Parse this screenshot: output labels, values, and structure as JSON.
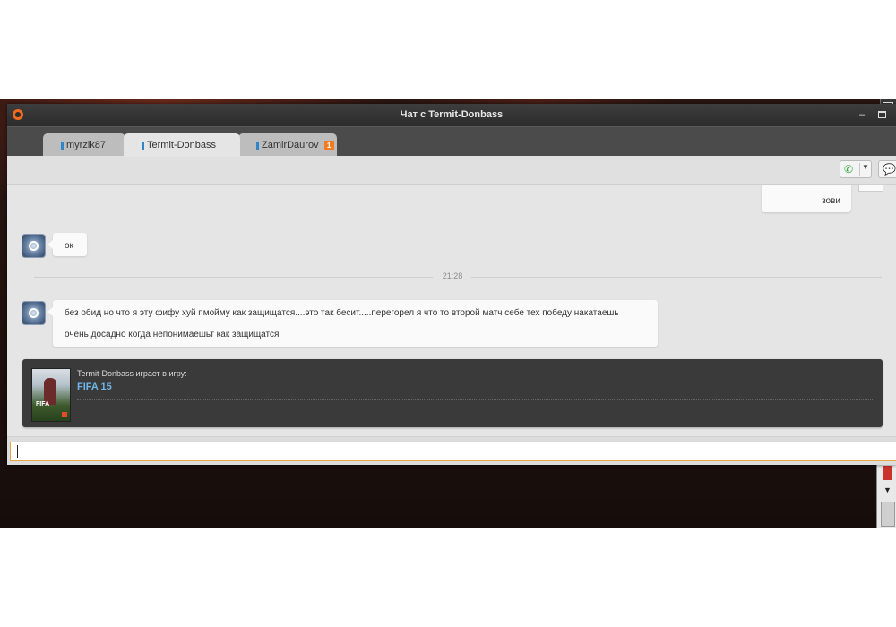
{
  "window": {
    "title": "Чат с Termit-Donbass",
    "minimize_glyph": "–"
  },
  "tabs": [
    {
      "label": "myrzik87",
      "active": false,
      "badge": ""
    },
    {
      "label": "Termit-Donbass",
      "active": true,
      "badge": ""
    },
    {
      "label": "ZamirDaurov",
      "active": false,
      "badge": "1"
    }
  ],
  "toolbar": {
    "call_icon": "phone-icon",
    "call_dropdown_icon": "chevron-down-icon",
    "chat_icon": "chat-bubbles-icon"
  },
  "messages": {
    "outgoing_last": "зови",
    "incoming_1": "ок",
    "divider_time": "21:28",
    "incoming_2_line1": "без обид но что я эту фифу хуй пмойму как защищатся....это так бесит.....перегорел я что то второй матч себе тех победу накатаешь",
    "incoming_2_line2": "очень досадно когда непонимаешьт как защищатся"
  },
  "game_card": {
    "playing_text": "Termit-Donbass играет в игру:",
    "game_name": "FIFA 15",
    "cover_text": "FIFA"
  },
  "input": {
    "value": ""
  },
  "colors": {
    "accent_orange": "#f27b1f",
    "status_blue": "#2f85c7",
    "game_link": "#6fb7ea",
    "call_green": "#34a33a"
  }
}
